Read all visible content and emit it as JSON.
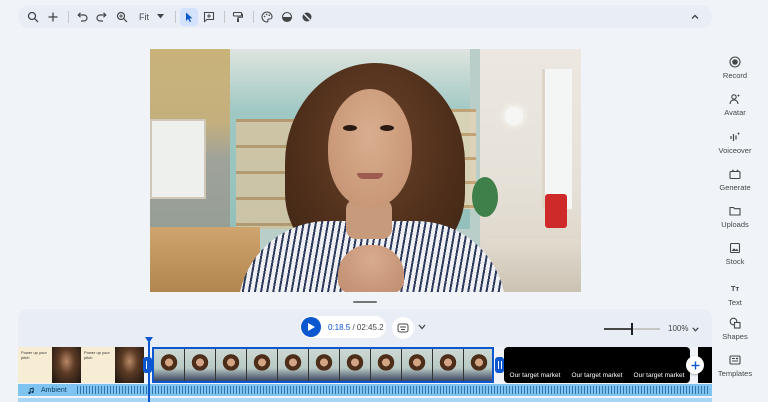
{
  "toolbar": {
    "fit_label": "Fit",
    "icons": [
      "search-icon",
      "plus-icon",
      "undo-icon",
      "redo-icon",
      "zoom-in-icon",
      "pointer-icon",
      "add-comment-icon",
      "paint-format-icon",
      "palette-icon",
      "fill-icon",
      "mask-icon",
      "chevron-up-icon"
    ]
  },
  "playback": {
    "current_time": "0:18.5",
    "separator": " / ",
    "total_time": "02:45.2",
    "zoom": "100%"
  },
  "zoom_level_fraction": 0.5,
  "timeline": {
    "pitch_thumb_text": "Power up your pitch",
    "target_label": "Our target market",
    "audio_track": "Ambient"
  },
  "sidebar": {
    "items": [
      {
        "label": "Record",
        "icon": "record-icon"
      },
      {
        "label": "Avatar",
        "icon": "avatar-icon"
      },
      {
        "label": "Voiceover",
        "icon": "voiceover-icon"
      },
      {
        "label": "Generate",
        "icon": "generate-icon"
      },
      {
        "label": "Uploads",
        "icon": "folder-icon"
      },
      {
        "label": "Stock",
        "icon": "stock-icon"
      },
      {
        "label": "Text",
        "icon": "text-icon"
      },
      {
        "label": "Shapes",
        "icon": "shapes-icon"
      },
      {
        "label": "Templates",
        "icon": "templates-icon"
      }
    ],
    "text_glyph": "Tт"
  },
  "colors": {
    "accent": "#0b57d0",
    "audio": "#7fc4f0",
    "background": "#f0f4f9"
  }
}
